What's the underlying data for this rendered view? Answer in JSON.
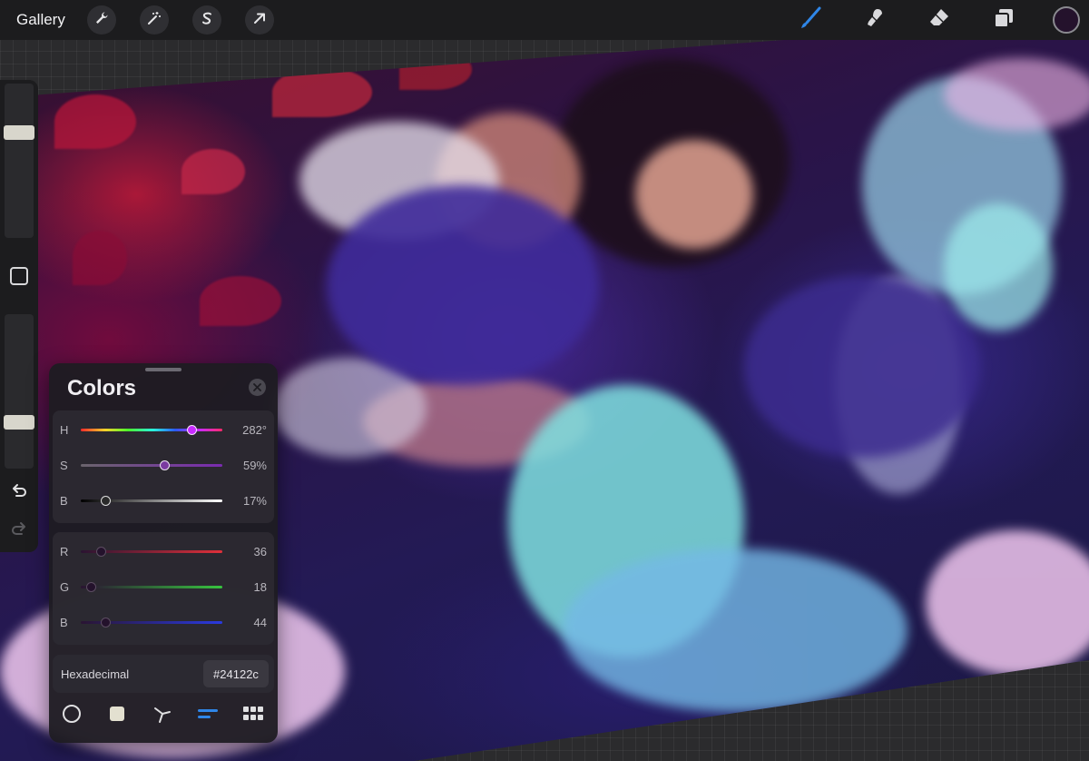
{
  "topbar": {
    "gallery_label": "Gallery",
    "left_tools": [
      "wrench-icon",
      "magic-wand-icon",
      "selection-s-icon",
      "transform-arrow-icon"
    ],
    "right_tools": [
      "brush-icon",
      "smudge-icon",
      "eraser-icon",
      "layers-icon"
    ],
    "active_tool": "brush-icon",
    "current_color": "#24122c",
    "accent_color": "#2f86e8"
  },
  "sidebar": {
    "brush_size_level": 0.3,
    "opacity_level": 0.72,
    "icons": [
      "modify-square-icon",
      "undo-icon",
      "redo-icon"
    ]
  },
  "colors_panel": {
    "title": "Colors",
    "hsb": [
      {
        "label": "H",
        "value": "282°",
        "level": 0.78
      },
      {
        "label": "S",
        "value": "59%",
        "level": 0.59
      },
      {
        "label": "B",
        "value": "17%",
        "level": 0.17
      }
    ],
    "rgb": [
      {
        "label": "R",
        "value": "36",
        "level": 0.14,
        "color": "#e0303a"
      },
      {
        "label": "G",
        "value": "18",
        "level": 0.07,
        "color": "#37c43f"
      },
      {
        "label": "B",
        "value": "44",
        "level": 0.17,
        "color": "#2a3ae0"
      }
    ],
    "hex_label": "Hexadecimal",
    "hex_value": "#24122c",
    "modes": [
      "disc-icon",
      "classic-icon",
      "harmony-icon",
      "value-icon",
      "palettes-icon"
    ],
    "active_mode": "value-icon"
  }
}
